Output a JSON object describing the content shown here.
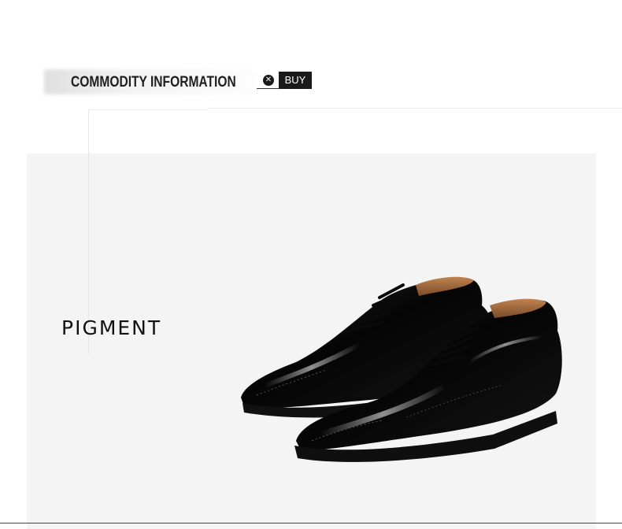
{
  "header": {
    "title": "COMMODITY INFORMATION",
    "buy_icon": "x-circle-icon",
    "buy_label": "BUY"
  },
  "feature": {
    "label": "PIGMENT",
    "product": "black patent leather wingtip brogue oxford shoes (pair)"
  },
  "colors": {
    "panel_background": "#f4f4f4",
    "text_dark": "#111111",
    "buy_background": "#1a1a1a",
    "buy_text": "#ffffff",
    "shoe_leather": "#0a0a0a",
    "shoe_lining": "#a56a3e"
  }
}
